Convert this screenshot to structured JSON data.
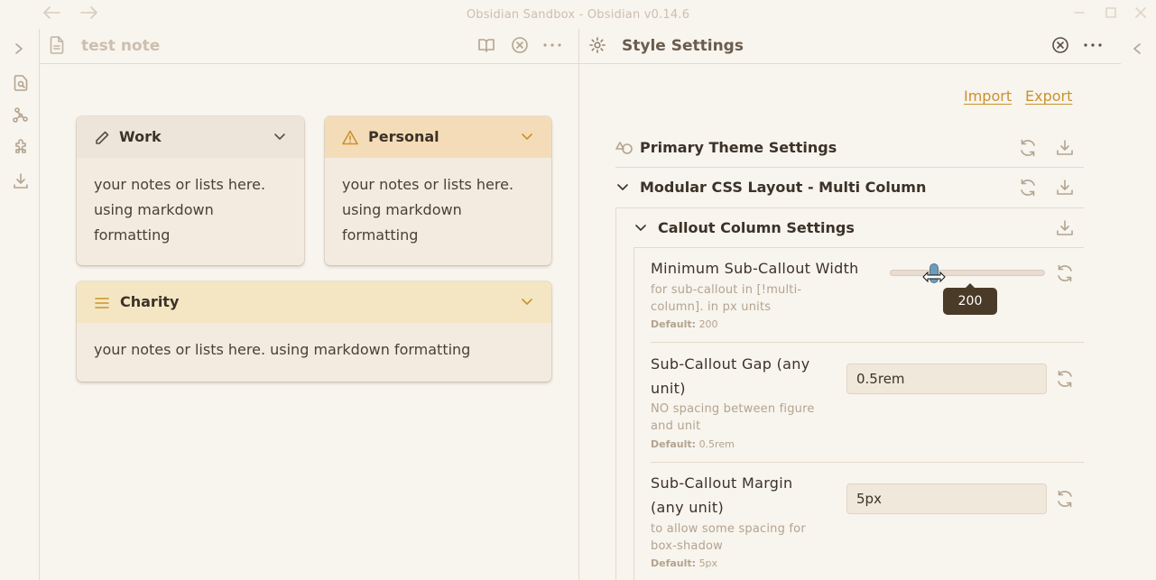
{
  "window": {
    "title": "Obsidian Sandbox - Obsidian v0.14.6"
  },
  "left_pane": {
    "note_title": "test note",
    "callouts": [
      {
        "title": "Work",
        "icon": "pencil-icon",
        "body": [
          "your notes or lists here.",
          "using markdown",
          "formatting"
        ],
        "color": "#ede4da"
      },
      {
        "title": "Personal",
        "icon": "warning-icon",
        "body": [
          "your notes or lists here.",
          "using markdown",
          "formatting"
        ],
        "color": "#f4dcb8"
      },
      {
        "title": "Charity",
        "icon": "list-icon",
        "body": [
          "your notes or lists here. using markdown formatting"
        ],
        "color": "#f4e6c3"
      }
    ]
  },
  "right_pane": {
    "title": "Style Settings",
    "import_label": "Import",
    "export_label": "Export",
    "sections": {
      "primary": "Primary Theme Settings",
      "modular": "Modular CSS Layout - Multi Column",
      "callout_column": "Callout Column Settings"
    },
    "settings": [
      {
        "name": [
          "Minimum Sub-Callout Width"
        ],
        "desc": [
          "for sub-callout in [!multi-",
          "column]. in px units"
        ],
        "default_label": "Default:",
        "default_value": "200",
        "slider_value": "200",
        "slider_fraction": 0.27
      },
      {
        "name": [
          "Sub-Callout Gap (any",
          "unit)"
        ],
        "desc": [
          "NO spacing between figure",
          "and unit"
        ],
        "default_label": "Default:",
        "default_value": "0.5rem",
        "input_value": "0.5rem"
      },
      {
        "name": [
          "Sub-Callout Margin",
          "(any unit)"
        ],
        "desc": [
          "to allow some spacing for",
          "box-shadow"
        ],
        "default_label": "Default:",
        "default_value": "5px",
        "input_value": "5px"
      }
    ]
  },
  "colors": {
    "background": "#f8f4ee",
    "accent": "#c9932a",
    "muted": "#b3a48f",
    "slider_thumb": "#6f9bb8"
  }
}
